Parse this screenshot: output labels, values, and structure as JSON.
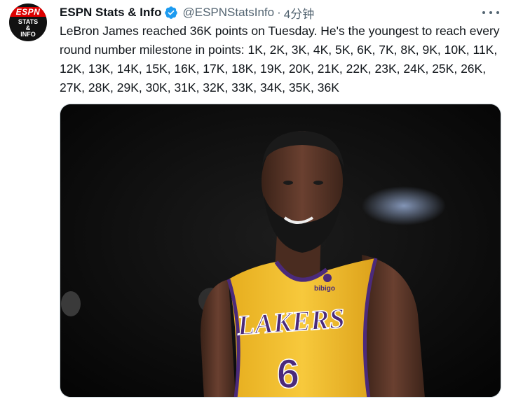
{
  "tweet": {
    "author": {
      "name": "ESPN Stats & Info",
      "handle": "@ESPNStatsInfo",
      "verified": true,
      "avatar": {
        "brand": "ESPN",
        "line1": "STATS",
        "line2": "&",
        "line3": "INFO"
      }
    },
    "separator": "·",
    "time": "4分钟",
    "text": "LeBron James reached 36K points on Tuesday. He's the youngest to reach every round number milestone in points: 1K, 2K, 3K, 4K, 5K, 6K, 7K, 8K, 9K, 10K, 11K, 12K, 13K, 14K, 15K, 16K, 17K, 18K, 19K, 20K, 21K, 22K, 23K, 24K, 25K, 26K, 27K, 28K, 29K, 30K, 31K, 32K, 33K, 34K, 35K, 36K",
    "photo": {
      "jersey_team": "LAKERS",
      "jersey_number": "6",
      "jersey_sponsor": "bibigo"
    }
  },
  "colors": {
    "verified_blue": "#1d9bf0",
    "secondary_text": "#536471",
    "jersey_gold": "#f5c12e",
    "jersey_purple": "#4b2a7b"
  }
}
